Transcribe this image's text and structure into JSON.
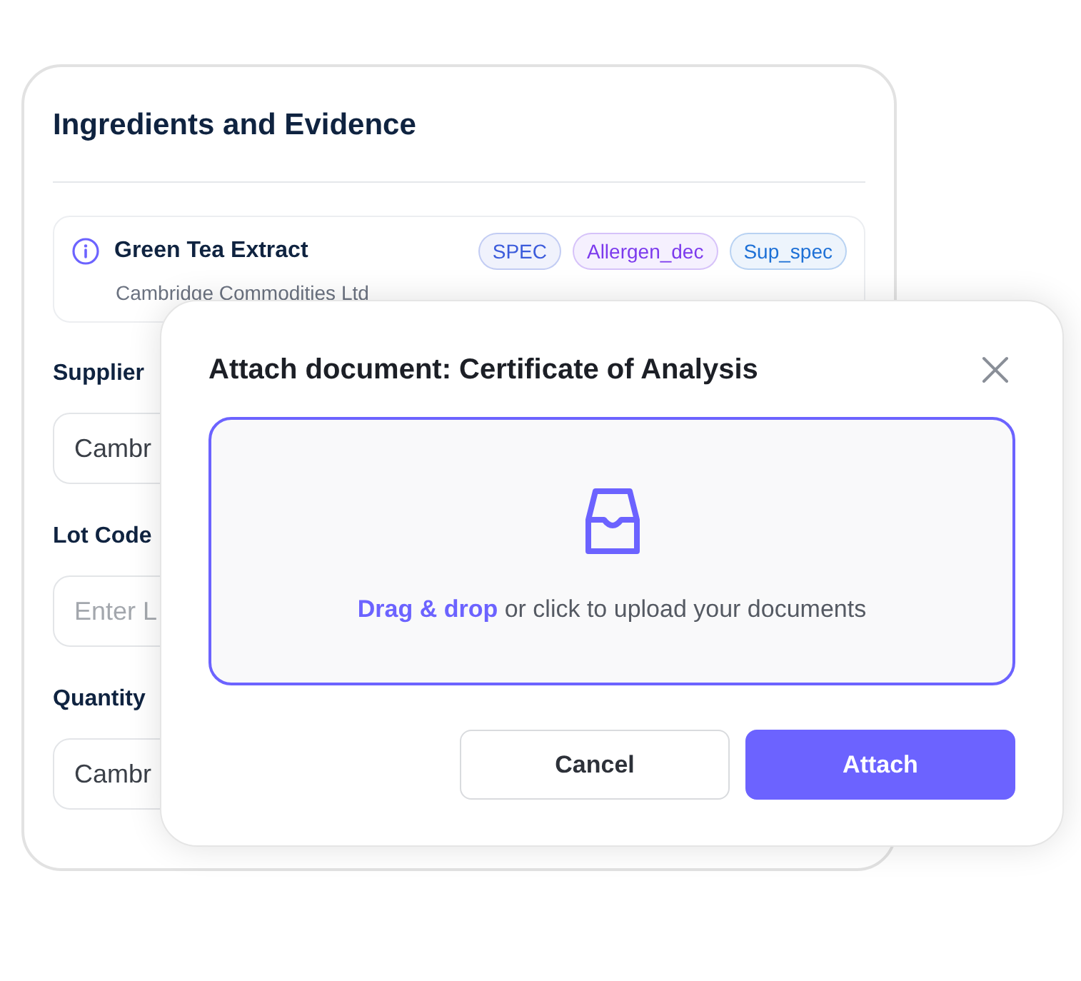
{
  "panel": {
    "title": "Ingredients and Evidence",
    "ingredient": {
      "name": "Green Tea Extract",
      "supplier": "Cambridge Commodities Ltd",
      "tags": [
        {
          "label": "SPEC",
          "color": "#3b5bdb"
        },
        {
          "label": "Allergen_dec",
          "color": "#7c3aed"
        },
        {
          "label": "Sup_spec",
          "color": "#1d70d6"
        }
      ]
    },
    "fields": [
      {
        "label": "Supplier",
        "value": "Cambr"
      },
      {
        "label": "Lot Code",
        "placeholder": "Enter L"
      },
      {
        "label": "Quantity",
        "value": "Cambr"
      }
    ]
  },
  "dialog": {
    "title": "Attach document: Certificate of Analysis",
    "dropzone": {
      "text": "**Drag & drop** or click to upload your documents"
    },
    "buttons": [
      {
        "label": "Cancel",
        "kind": "secondary"
      },
      {
        "label": "Attach",
        "kind": "primary"
      }
    ]
  }
}
